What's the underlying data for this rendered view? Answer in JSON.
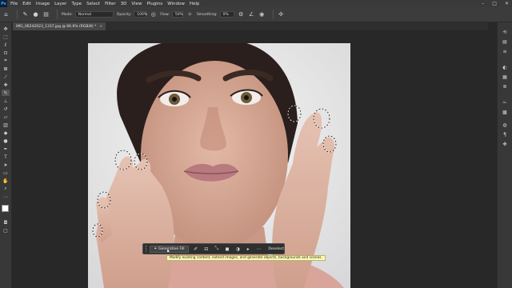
{
  "menubar": {
    "logo": "Ps",
    "items": [
      "File",
      "Edit",
      "Image",
      "Layer",
      "Type",
      "Select",
      "Filter",
      "3D",
      "View",
      "Plugins",
      "Window",
      "Help"
    ]
  },
  "options_bar": {
    "mode_label": "Mode:",
    "mode_value": "Normal",
    "opacity_label": "Opacity:",
    "opacity_value": "100%",
    "flow_label": "Flow:",
    "flow_value": "50%",
    "smoothing_label": "Smoothing:",
    "smoothing_value": "0%"
  },
  "document": {
    "tab_title": "IMG_06242023_1337.jpg @ 66.6% (RGB/8) *"
  },
  "context_bar": {
    "generative_fill_label": "Generative Fill",
    "deselect_label": "Deselect",
    "tooltip": "Modify existing content, extend images, and generate objects, backgrounds and scenes."
  },
  "colors": {
    "menubar": "#3a3a3a",
    "workspace": "#282828",
    "panel": "#383838",
    "tooltip_bg": "#fffbb7"
  }
}
